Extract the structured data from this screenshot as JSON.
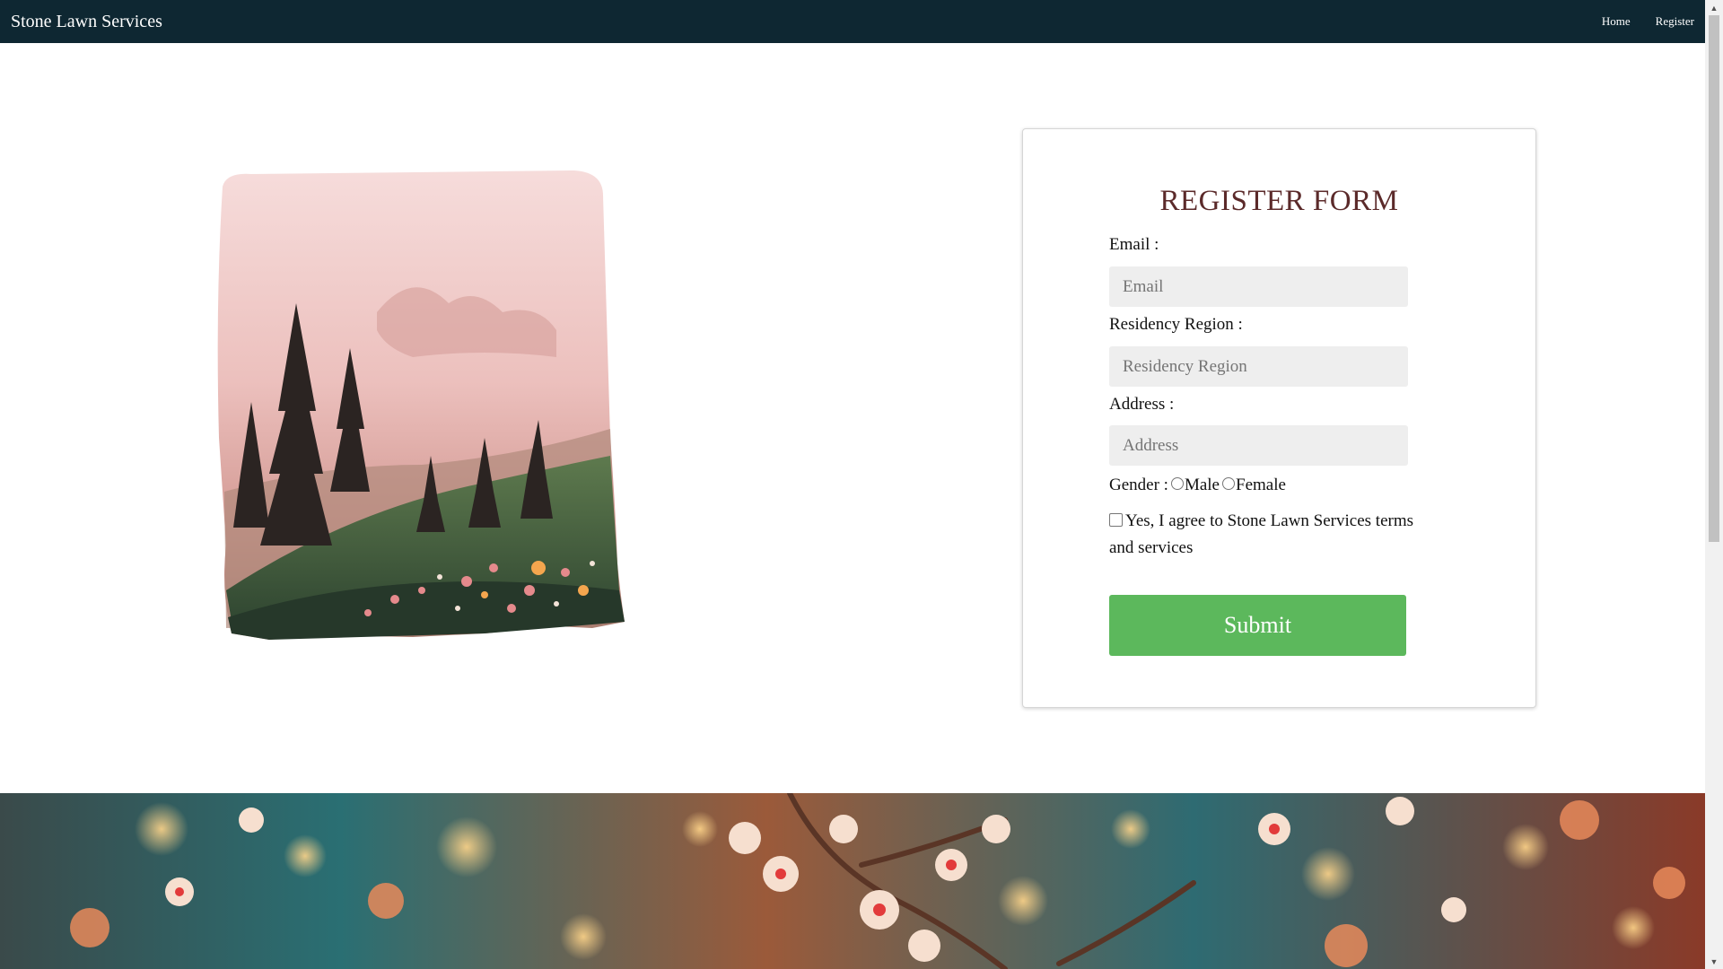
{
  "navbar": {
    "brand": "Stone Lawn Services",
    "links": [
      "Home",
      "Register"
    ]
  },
  "form": {
    "title": "REGISTER FORM",
    "email_label": "Email :",
    "email_placeholder": "Email",
    "region_label": "Residency Region :",
    "region_placeholder": "Residency Region",
    "address_label": "Address :",
    "address_placeholder": "Address",
    "gender_label": "Gender :",
    "gender_options": [
      "Male",
      "Female"
    ],
    "agree_text": "Yes, I agree to Stone Lawn Services terms and services",
    "submit_label": "Submit"
  },
  "colors": {
    "navbar_bg": "#0e2732",
    "title": "#5b2a2a",
    "submit": "#5cb85c",
    "input_bg": "#eeeeee"
  },
  "icons": {
    "scroll_up": "triangle-up-icon",
    "scroll_down": "triangle-down-icon"
  }
}
